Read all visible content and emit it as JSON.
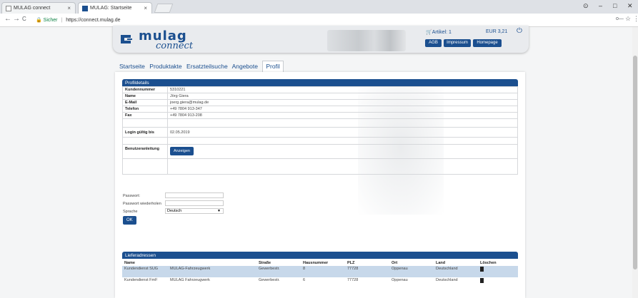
{
  "browser": {
    "tabs": [
      {
        "title": "MULAG connect",
        "close": "×"
      },
      {
        "title": "MULAG: Startseite",
        "close": "×"
      }
    ],
    "window_controls": [
      "–",
      "□",
      "✕"
    ],
    "nav": {
      "back": "←",
      "forward": "→",
      "reload": "C"
    },
    "address": {
      "secure_label": "Sicher",
      "url": "https://connect.mulag.de"
    },
    "toolbar_icons": [
      "key-icon",
      "star-icon",
      "menu-icon"
    ],
    "star": "☆",
    "menu": "⋮",
    "key": "🔑"
  },
  "header": {
    "logo_word": "mulag",
    "logo_sub": "connect",
    "cart_label": "Artikel: 1",
    "cart_total": "EUR 3,21",
    "power_icon": "⏻",
    "buttons": [
      "AGB",
      "Impressum",
      "Homepage"
    ]
  },
  "mainnav": {
    "items": [
      "Startseite",
      "Produktakte",
      "Ersatzteilsuche",
      "Angebote",
      "Profil"
    ],
    "active_index": 4
  },
  "profile": {
    "title": "Profildetails",
    "rows": [
      {
        "key": "Kundennummer",
        "value": "5310221"
      },
      {
        "key": "Name",
        "value": "Jörg Giera"
      },
      {
        "key": "E-Mail",
        "value": "joerg.giera@mulag.de"
      },
      {
        "key": "Telefon",
        "value": "+49 7804 913-347"
      },
      {
        "key": "Fax",
        "value": "+49 7804 913-208"
      }
    ],
    "login_label": "Login gültig bis",
    "login_value": "02.05.2019",
    "manual_label": "Benutzeranleitung",
    "manual_button": "Anzeigen"
  },
  "password_form": {
    "password_label": "Passwort:",
    "repeat_label": "Passwort wiederholen",
    "language_label": "Sprache",
    "language_value": "Deutsch",
    "ok_button": "OK"
  },
  "addresses": {
    "title": "Lieferadressen",
    "columns": [
      "Name",
      "",
      "Straße",
      "Hausnummer",
      "PLZ",
      "Ort",
      "Land",
      "Löschen"
    ],
    "rows": [
      {
        "name": "Kundendienst SUG",
        "company": "MULAG-Fahrzeugwerk",
        "street": "Gewerbestr.",
        "number": "8",
        "zip": "77728",
        "city": "Oppenau",
        "country": "Deutschland",
        "selected": true
      },
      {
        "name": "Kundendienst FmF",
        "company": "MULAG Fahrzeugwerk",
        "street": "Gewerbestr.",
        "number": "6",
        "zip": "77728",
        "city": "Oppenau",
        "country": "Deutschland",
        "selected": false
      }
    ]
  },
  "colors": {
    "brand": "#1b4f8f",
    "selected_row": "#c7d8ea",
    "secure": "#0b8043"
  }
}
